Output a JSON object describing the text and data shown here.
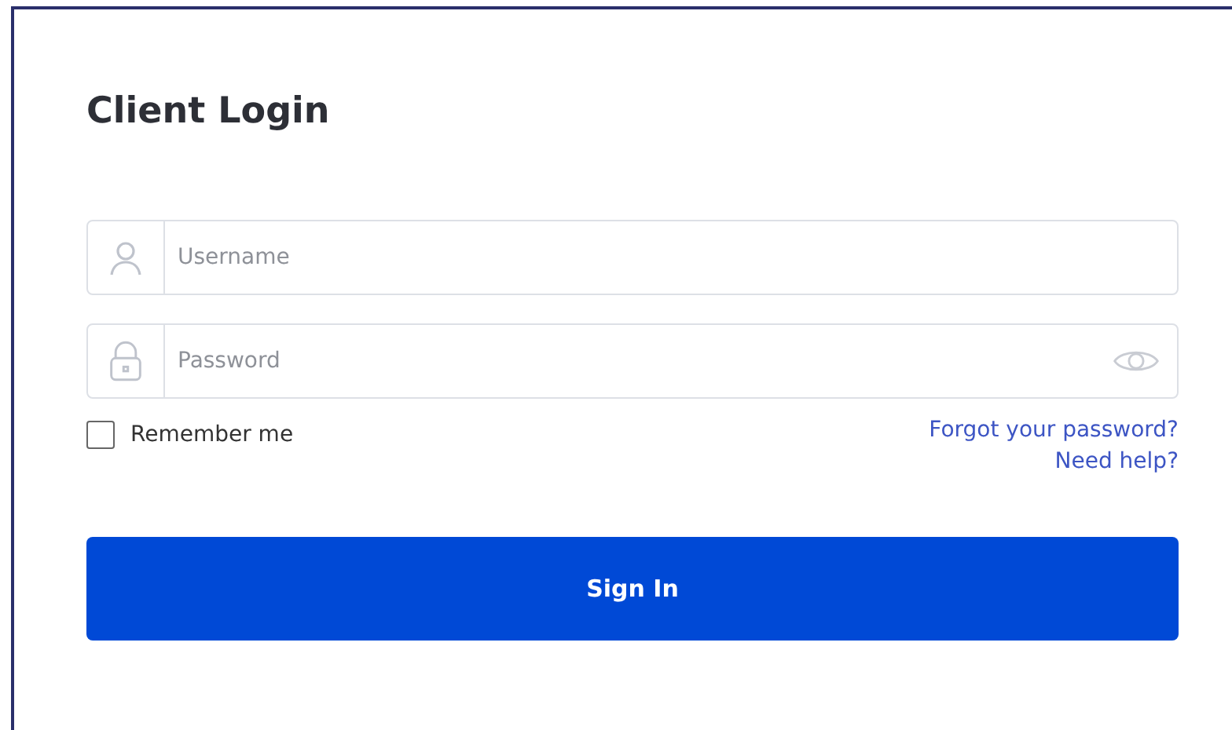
{
  "title": "Client Login",
  "fields": [
    {
      "kind": "username",
      "placeholder": "Username"
    },
    {
      "kind": "password",
      "placeholder": "Password"
    }
  ],
  "remember": {
    "label": "Remember me",
    "checked": false
  },
  "links": [
    "Forgot your password?",
    "Need help?"
  ],
  "submit": "Sign In"
}
